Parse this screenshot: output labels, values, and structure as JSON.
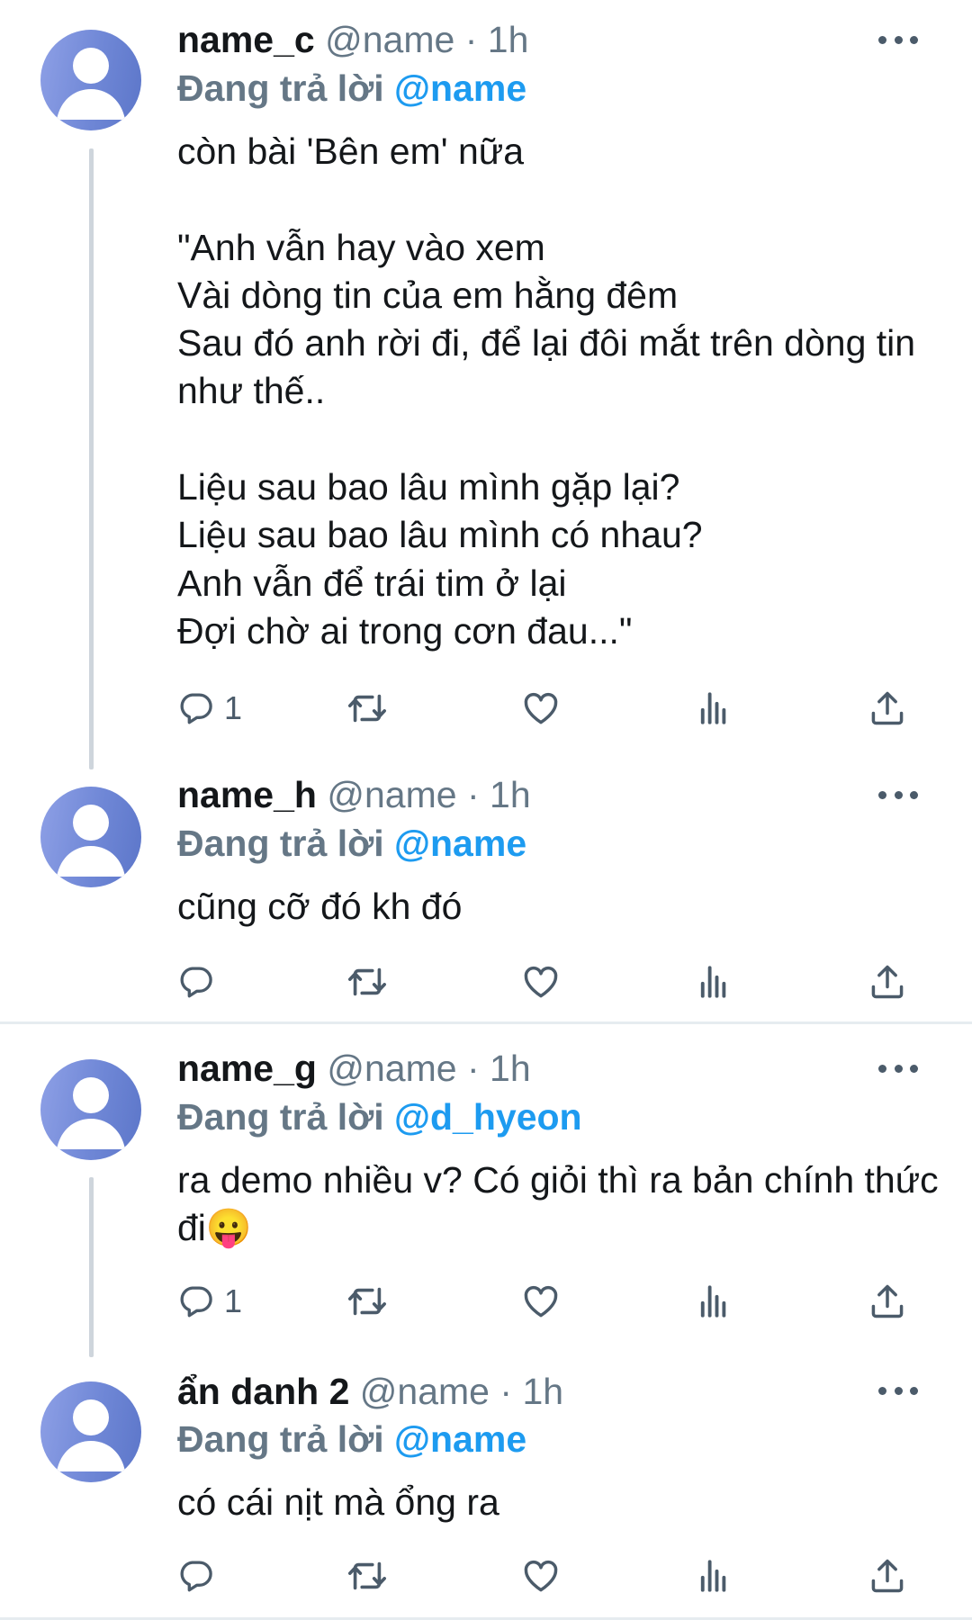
{
  "colors": {
    "accent": "#1d9bf0",
    "muted": "#657786",
    "text": "#14171a",
    "divider": "#e6ecf0",
    "avatar": "#6f87d6"
  },
  "icons": {
    "more": "more-dots-icon",
    "reply": "reply-bubble-icon",
    "retweet": "retweet-icon",
    "like": "heart-icon",
    "views": "analytics-bars-icon",
    "share": "share-upload-icon"
  },
  "tweets": [
    {
      "name": "name_c",
      "handle": "@name",
      "sep": "·",
      "time": "1h",
      "reply_prefix": "Đang trả lời",
      "reply_to": "@name",
      "text": "còn bài 'Bên em' nữa\n\n\"Anh vẫn hay vào xem\nVài dòng tin của em hằng đêm\nSau đó anh rời đi, để lại đôi mắt trên dòng tin như thế..\n\nLiệu sau bao lâu mình gặp lại?\nLiệu sau bao lâu mình có nhau?\nAnh vẫn để trái tim ở lại\nĐợi chờ ai trong cơn đau...\"",
      "reply_count": "1"
    },
    {
      "name": "name_h",
      "handle": "@name",
      "sep": "·",
      "time": "1h",
      "reply_prefix": "Đang trả lời",
      "reply_to": "@name",
      "text": "cũng cỡ đó kh đó",
      "reply_count": ""
    },
    {
      "name": "name_g",
      "handle": "@name",
      "sep": "·",
      "time": "1h",
      "reply_prefix": "Đang trả lời",
      "reply_to": "@d_hyeon",
      "text": "ra demo nhiều v? Có giỏi thì ra bản chính thức đi😛",
      "reply_count": "1"
    },
    {
      "name": "ẩn danh 2",
      "handle": "@name",
      "sep": "·",
      "time": "1h",
      "reply_prefix": "Đang trả lời",
      "reply_to": "@name",
      "text": "có cái nịt mà ổng ra",
      "reply_count": ""
    }
  ]
}
